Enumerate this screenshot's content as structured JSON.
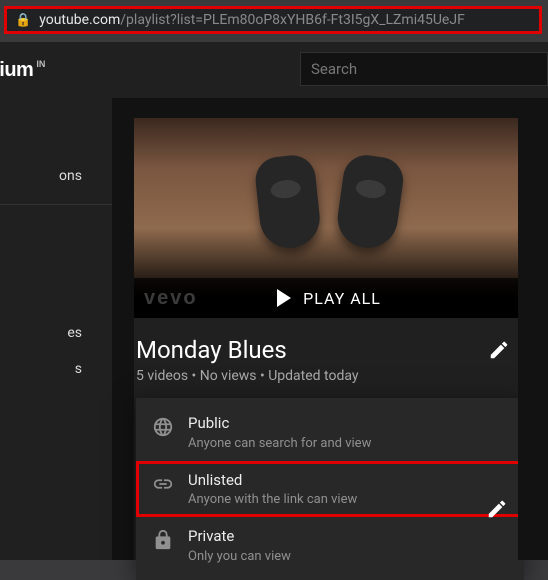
{
  "url": {
    "domain": "youtube.com",
    "path": "/playlist?list=PLEm80oP8xYHB6f-Ft3I5gX_LZmi45UeJF"
  },
  "header": {
    "logo_suffix": "mium",
    "country_code": "IN",
    "search_placeholder": "Search"
  },
  "sidebar": {
    "item1": "ons",
    "item2": "es",
    "item3": "s"
  },
  "playlist": {
    "play_all": "PLAY ALL",
    "watermark": "vevo",
    "title": "Monday Blues",
    "meta": "5 videos • No views • Updated today"
  },
  "privacy": {
    "public": {
      "label": "Public",
      "desc": "Anyone can search for and view"
    },
    "unlisted": {
      "label": "Unlisted",
      "desc": "Anyone with the link can view"
    },
    "private": {
      "label": "Private",
      "desc": "Only you can view"
    }
  }
}
